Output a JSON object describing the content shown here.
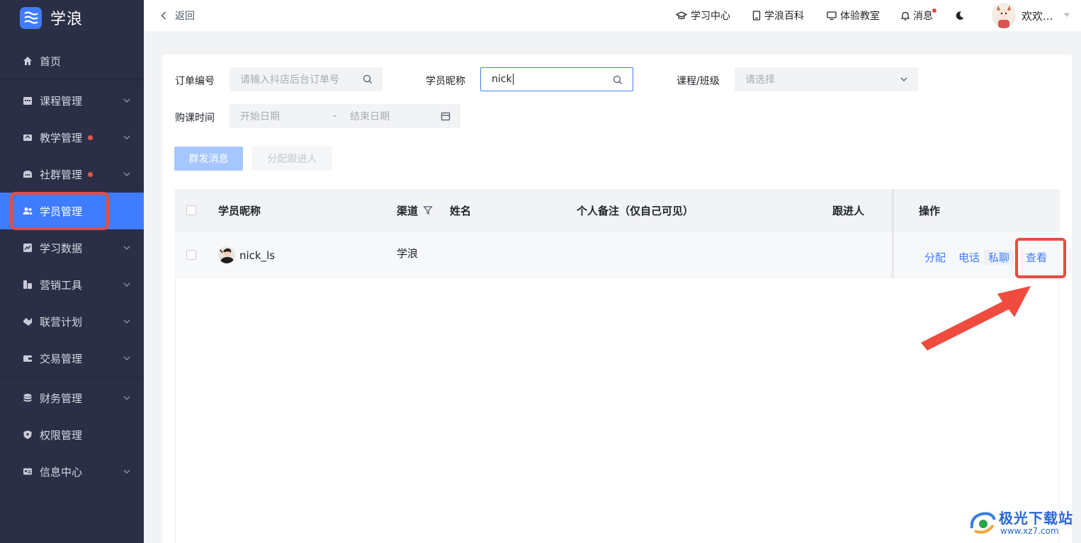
{
  "brand": {
    "name": "学浪"
  },
  "sidebar": {
    "items": [
      {
        "key": "home",
        "label": "首页",
        "icon": "home-icon",
        "chevron": false,
        "dot": false,
        "active": false
      },
      {
        "key": "course",
        "label": "课程管理",
        "icon": "calendar-icon",
        "chevron": true,
        "dot": false,
        "active": false
      },
      {
        "key": "teaching",
        "label": "教学管理",
        "icon": "teaching-icon",
        "chevron": true,
        "dot": true,
        "active": false
      },
      {
        "key": "community",
        "label": "社群管理",
        "icon": "chat-icon",
        "chevron": true,
        "dot": true,
        "active": false
      },
      {
        "key": "students",
        "label": "学员管理",
        "icon": "users-icon",
        "chevron": false,
        "dot": false,
        "active": true
      },
      {
        "key": "data",
        "label": "学习数据",
        "icon": "chart-icon",
        "chevron": true,
        "dot": false,
        "active": false
      },
      {
        "key": "marketing",
        "label": "营销工具",
        "icon": "marketing-icon",
        "chevron": true,
        "dot": false,
        "active": false
      },
      {
        "key": "alliance",
        "label": "联营计划",
        "icon": "handshake-icon",
        "chevron": true,
        "dot": false,
        "active": false
      },
      {
        "key": "trade",
        "label": "交易管理",
        "icon": "wallet-icon",
        "chevron": true,
        "dot": false,
        "active": false
      },
      {
        "key": "finance",
        "label": "财务管理",
        "icon": "coins-icon",
        "chevron": true,
        "dot": false,
        "active": false
      },
      {
        "key": "permission",
        "label": "权限管理",
        "icon": "shield-icon",
        "chevron": false,
        "dot": false,
        "active": false
      },
      {
        "key": "info",
        "label": "信息中心",
        "icon": "id-card-icon",
        "chevron": true,
        "dot": false,
        "active": false
      }
    ]
  },
  "header": {
    "back_label": "返回",
    "nav": [
      {
        "label": "学习中心",
        "icon": "graduation-cap-icon"
      },
      {
        "label": "学浪百科",
        "icon": "book-icon"
      },
      {
        "label": "体验教室",
        "icon": "monitor-icon"
      },
      {
        "label": "消息",
        "icon": "bell-icon"
      }
    ],
    "theme_icon": "moon-icon",
    "username": "欢欢..."
  },
  "filters": {
    "order_label": "订单编号",
    "order_placeholder": "请输入抖店后台订单号",
    "nickname_label": "学员昵称",
    "nickname_value": "nick",
    "course_label": "课程/班级",
    "course_placeholder": "请选择",
    "time_label": "购课时间",
    "start_placeholder": "开始日期",
    "range_sep": "-",
    "end_placeholder": "结束日期"
  },
  "actions": {
    "mass_message": "群发消息",
    "assign_follower": "分配跟进人"
  },
  "table": {
    "columns": {
      "nickname": "学员昵称",
      "channel": "渠道",
      "name": "姓名",
      "note": "个人备注（仅自己可见）",
      "follower": "跟进人",
      "operation": "操作"
    },
    "rows": [
      {
        "nickname": "nick_ls",
        "channel": "学浪",
        "name": "",
        "note": "",
        "follower": "",
        "ops": {
          "assign": "分配",
          "phone": "电话",
          "chat": "私聊",
          "view": "查看"
        }
      }
    ]
  },
  "watermark": {
    "text": "极光下载站",
    "url": "www.xz7.com"
  },
  "colors": {
    "primary": "#3f7cff",
    "sidebar": "#2b2f45",
    "highlight": "#e94b3f"
  }
}
